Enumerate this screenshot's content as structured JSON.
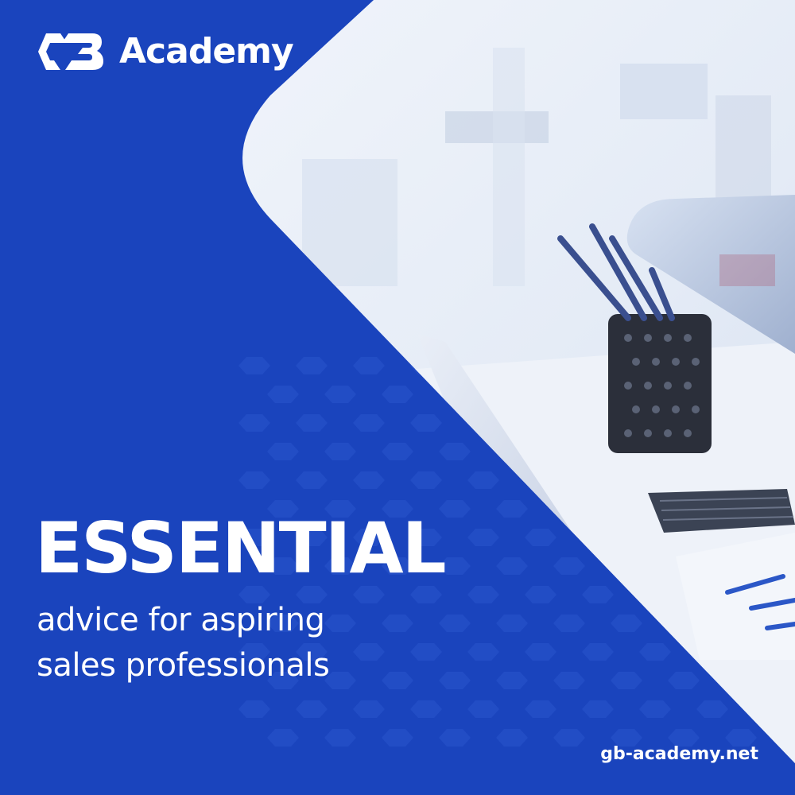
{
  "brand": {
    "logo_icon": "gb-logo-icon",
    "name": "Academy"
  },
  "headline": "ESSENTIAL",
  "subline": {
    "line1": "advice for aspiring",
    "line2": "sales professionals"
  },
  "website": "gb-academy.net",
  "colors": {
    "background": "#1a44bd",
    "text": "#ffffff",
    "photo_light": "#eef3fa"
  }
}
